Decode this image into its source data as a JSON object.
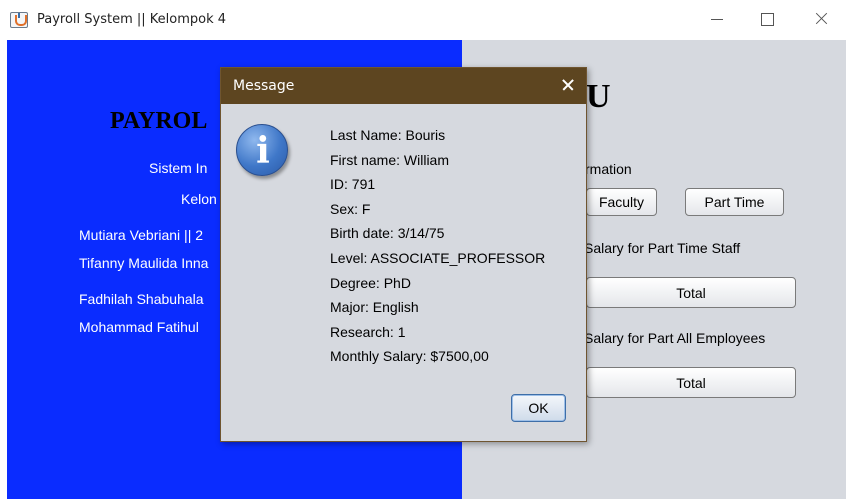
{
  "window": {
    "title": "Payroll System || Kelompok 4",
    "app_icon": "java-cup-icon"
  },
  "left_panel": {
    "heading_partial": "PAYROL",
    "labels": [
      "Sistem In",
      "Kelon",
      "Mutiara Vebriani || 2",
      "Tifanny Maulida Inna",
      "Fadhilah Shabuhala",
      "Mohammad Fatihul"
    ],
    "background_color": "#0a2cff"
  },
  "right_panel": {
    "heading_partial": "U",
    "info_label": "rmation",
    "faculty_button": "Faculty",
    "part_time_button": "Part Time",
    "salary_part_time_label": "Salary for Part Time Staff",
    "total_button_1": "Total",
    "salary_all_label": "Salary for Part All Employees",
    "total_button_2": "Total",
    "background_color": "#d6d9df"
  },
  "dialog": {
    "title": "Message",
    "icon": "info-icon",
    "icon_glyph": "i",
    "lines": [
      "Last Name: Bouris",
      "First name: William",
      "ID: 791",
      "Sex: F",
      "Birth date: 3/14/75",
      "Level: ASSOCIATE_PROFESSOR",
      "Degree: PhD",
      "Major: English",
      "Research: 1",
      "Monthly Salary: $7500,00"
    ],
    "ok_button": "OK",
    "titlebar_color": "#5d4520"
  }
}
